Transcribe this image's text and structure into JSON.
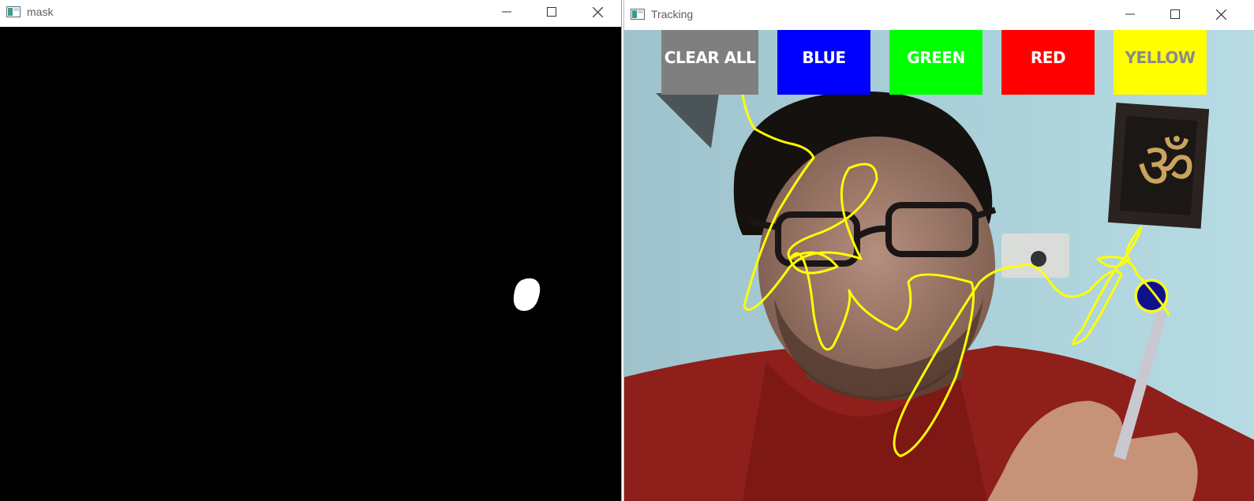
{
  "mask_window": {
    "title": "mask",
    "controls": {
      "minimize": "minimize-icon",
      "maximize": "maximize-icon",
      "close": "close-icon"
    }
  },
  "tracking_window": {
    "title": "Tracking",
    "controls": {
      "minimize": "minimize-icon",
      "maximize": "maximize-icon",
      "close": "close-icon"
    },
    "color_buttons": [
      {
        "label": "CLEAR ALL",
        "bg": "#7f7f7f",
        "text_color": "#ffffff"
      },
      {
        "label": "BLUE",
        "bg": "#0000ff",
        "text_color": "#ffffff"
      },
      {
        "label": "GREEN",
        "bg": "#00ff00",
        "text_color": "#ffffff"
      },
      {
        "label": "RED",
        "bg": "#ff0000",
        "text_color": "#ffffff"
      },
      {
        "label": "YELLOW",
        "bg": "#ffff00",
        "text_color": "#8a8a8a"
      }
    ],
    "stroke_color": "#ffff00",
    "marker_color": "#10118a"
  }
}
